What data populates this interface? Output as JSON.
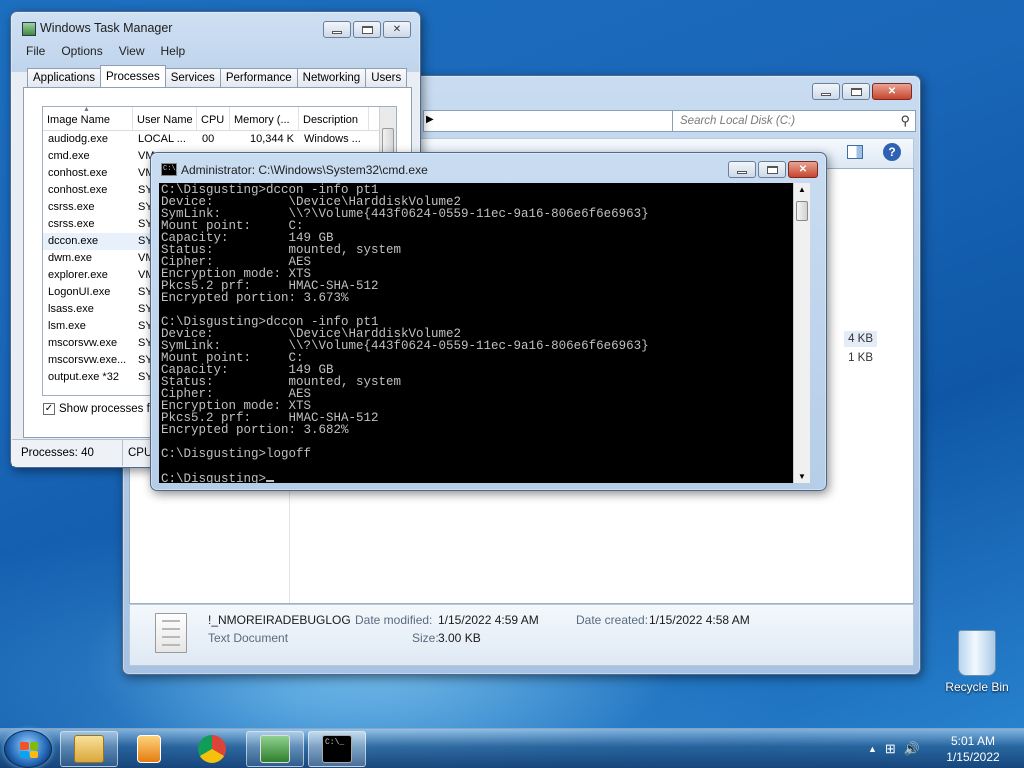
{
  "explorer": {
    "search_placeholder": "Search Local Disk (C:)",
    "rows": [
      {
        "size": "4 KB"
      },
      {
        "size": "1 KB"
      }
    ],
    "details": {
      "file_name": "!_NMOREIRADEBUGLOG",
      "file_type": "Text Document",
      "modified_label": "Date modified:",
      "modified_value": "1/15/2022 4:59 AM",
      "created_label": "Date created:",
      "created_value": "1/15/2022 4:58 AM",
      "size_label": "Size:",
      "size_value": "3.00 KB"
    }
  },
  "taskmgr": {
    "title": "Windows Task Manager",
    "menu": [
      "File",
      "Options",
      "View",
      "Help"
    ],
    "tabs": [
      "Applications",
      "Processes",
      "Services",
      "Performance",
      "Networking",
      "Users"
    ],
    "active_tab": "Processes",
    "columns": [
      "Image Name",
      "User Name",
      "CPU",
      "Memory (...",
      "Description"
    ],
    "processes": [
      {
        "name": "audiodg.exe",
        "user": "LOCAL ...",
        "cpu": "00",
        "mem": "10,344 K",
        "desc": "Windows ..."
      },
      {
        "name": "cmd.exe",
        "user": "VM",
        "cpu": "",
        "mem": "",
        "desc": ""
      },
      {
        "name": "conhost.exe",
        "user": "VM",
        "cpu": "",
        "mem": "",
        "desc": ""
      },
      {
        "name": "conhost.exe",
        "user": "SY",
        "cpu": "",
        "mem": "",
        "desc": ""
      },
      {
        "name": "csrss.exe",
        "user": "SY",
        "cpu": "",
        "mem": "",
        "desc": ""
      },
      {
        "name": "csrss.exe",
        "user": "SY",
        "cpu": "",
        "mem": "",
        "desc": ""
      },
      {
        "name": "dccon.exe",
        "user": "SY",
        "cpu": "",
        "mem": "",
        "desc": ""
      },
      {
        "name": "dwm.exe",
        "user": "VM",
        "cpu": "",
        "mem": "",
        "desc": ""
      },
      {
        "name": "explorer.exe",
        "user": "VM",
        "cpu": "",
        "mem": "",
        "desc": ""
      },
      {
        "name": "LogonUI.exe",
        "user": "SY",
        "cpu": "",
        "mem": "",
        "desc": ""
      },
      {
        "name": "lsass.exe",
        "user": "SY",
        "cpu": "",
        "mem": "",
        "desc": ""
      },
      {
        "name": "lsm.exe",
        "user": "SY",
        "cpu": "",
        "mem": "",
        "desc": ""
      },
      {
        "name": "mscorsvw.exe",
        "user": "SY",
        "cpu": "",
        "mem": "",
        "desc": ""
      },
      {
        "name": "mscorsvw.exe...",
        "user": "SY",
        "cpu": "",
        "mem": "",
        "desc": ""
      },
      {
        "name": "output.exe *32",
        "user": "SY",
        "cpu": "",
        "mem": "",
        "desc": ""
      }
    ],
    "show_processes_label": "Show processes fro",
    "status_processes": "Processes: 40",
    "status_cpu": "CPU"
  },
  "cmd": {
    "title": "Administrator: C:\\Windows\\System32\\cmd.exe",
    "lines": [
      "C:\\Disgusting>dccon -info pt1",
      "Device:          \\Device\\HarddiskVolume2",
      "SymLink:         \\\\?\\Volume{443f0624-0559-11ec-9a16-806e6f6e6963}",
      "Mount point:     C:",
      "Capacity:        149 GB",
      "Status:          mounted, system",
      "Cipher:          AES",
      "Encryption mode: XTS",
      "Pkcs5.2 prf:     HMAC-SHA-512",
      "Encrypted portion: 3.673%",
      "",
      "C:\\Disgusting>dccon -info pt1",
      "Device:          \\Device\\HarddiskVolume2",
      "SymLink:         \\\\?\\Volume{443f0624-0559-11ec-9a16-806e6f6e6963}",
      "Mount point:     C:",
      "Capacity:        149 GB",
      "Status:          mounted, system",
      "Cipher:          AES",
      "Encryption mode: XTS",
      "Pkcs5.2 prf:     HMAC-SHA-512",
      "Encrypted portion: 3.682%",
      "",
      "C:\\Disgusting>logoff",
      "",
      "C:\\Disgusting>"
    ]
  },
  "desktop": {
    "recycle_bin": "Recycle Bin"
  },
  "taskbar": {
    "time": "5:01 AM",
    "date": "1/15/2022"
  }
}
